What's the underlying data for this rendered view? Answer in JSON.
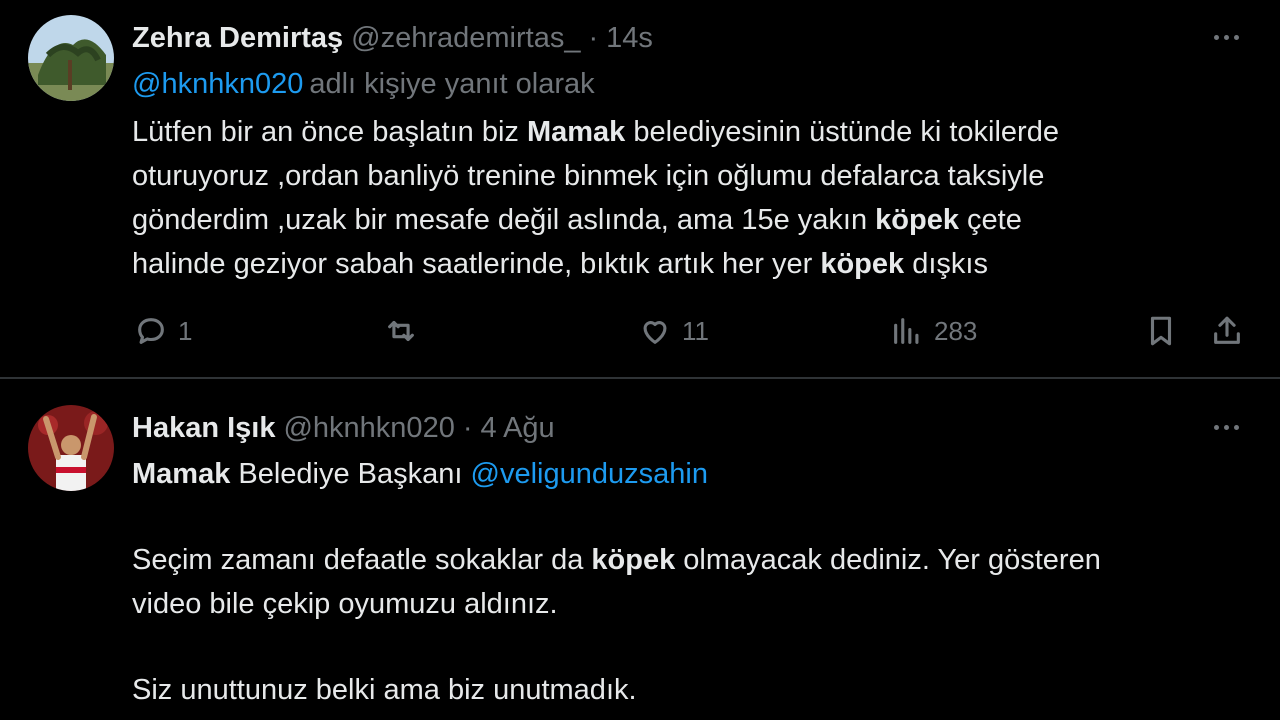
{
  "tweet1": {
    "author_name": "Zehra Demirtaş",
    "author_handle": "@zehrademirtas_",
    "dot": "·",
    "time": "14s",
    "reply_mention": "@hknhkn020",
    "reply_rest": "adlı kişiye yanıt olarak",
    "lines": [
      {
        "pre": "Lütfen bir an önce başlatın biz ",
        "bold": "Mamak",
        "post": " belediyesinin üstünde ki tokilerde"
      },
      {
        "pre": "oturuyoruz ,ordan banliyö trenine binmek için oğlumu defalarca taksiyle",
        "bold": "",
        "post": ""
      },
      {
        "pre": "gönderdim ,uzak bir mesafe değil aslında, ama 15e yakın ",
        "bold": "köpek",
        "post": " çete"
      },
      {
        "pre": "halinde geziyor sabah saatlerinde, bıktık artık her yer ",
        "bold": "köpek",
        "post": " dışkıs"
      }
    ],
    "actions": {
      "reply_count": "1",
      "retweet_count": "",
      "like_count": "11",
      "view_count": "283"
    }
  },
  "tweet2": {
    "author_name": "Hakan Işık",
    "author_handle": "@hknhkn020",
    "dot": "·",
    "time": "4 Ağu",
    "line1_bold": "Mamak",
    "line1_text": " Belediye Başkanı ",
    "line1_mention": "@veligunduzsahin",
    "line2_pre": "Seçim zamanı defaatle sokaklar da ",
    "line2_bold": "köpek",
    "line2_post": " olmayacak dediniz. Yer gösteren",
    "line3": "video bile çekip oyumuzu aldınız.",
    "line4": "Siz unuttunuz belki ama biz unutmadık."
  },
  "icons": {
    "reply": "reply-icon",
    "retweet": "retweet-icon",
    "like": "heart-icon",
    "views": "views-icon",
    "bookmark": "bookmark-icon",
    "share": "share-icon",
    "more": "more-icon"
  },
  "colors": {
    "background": "#000000",
    "text": "#e7e9ea",
    "muted": "#71767b",
    "link": "#1d9bf0",
    "divider": "#2f3336"
  }
}
